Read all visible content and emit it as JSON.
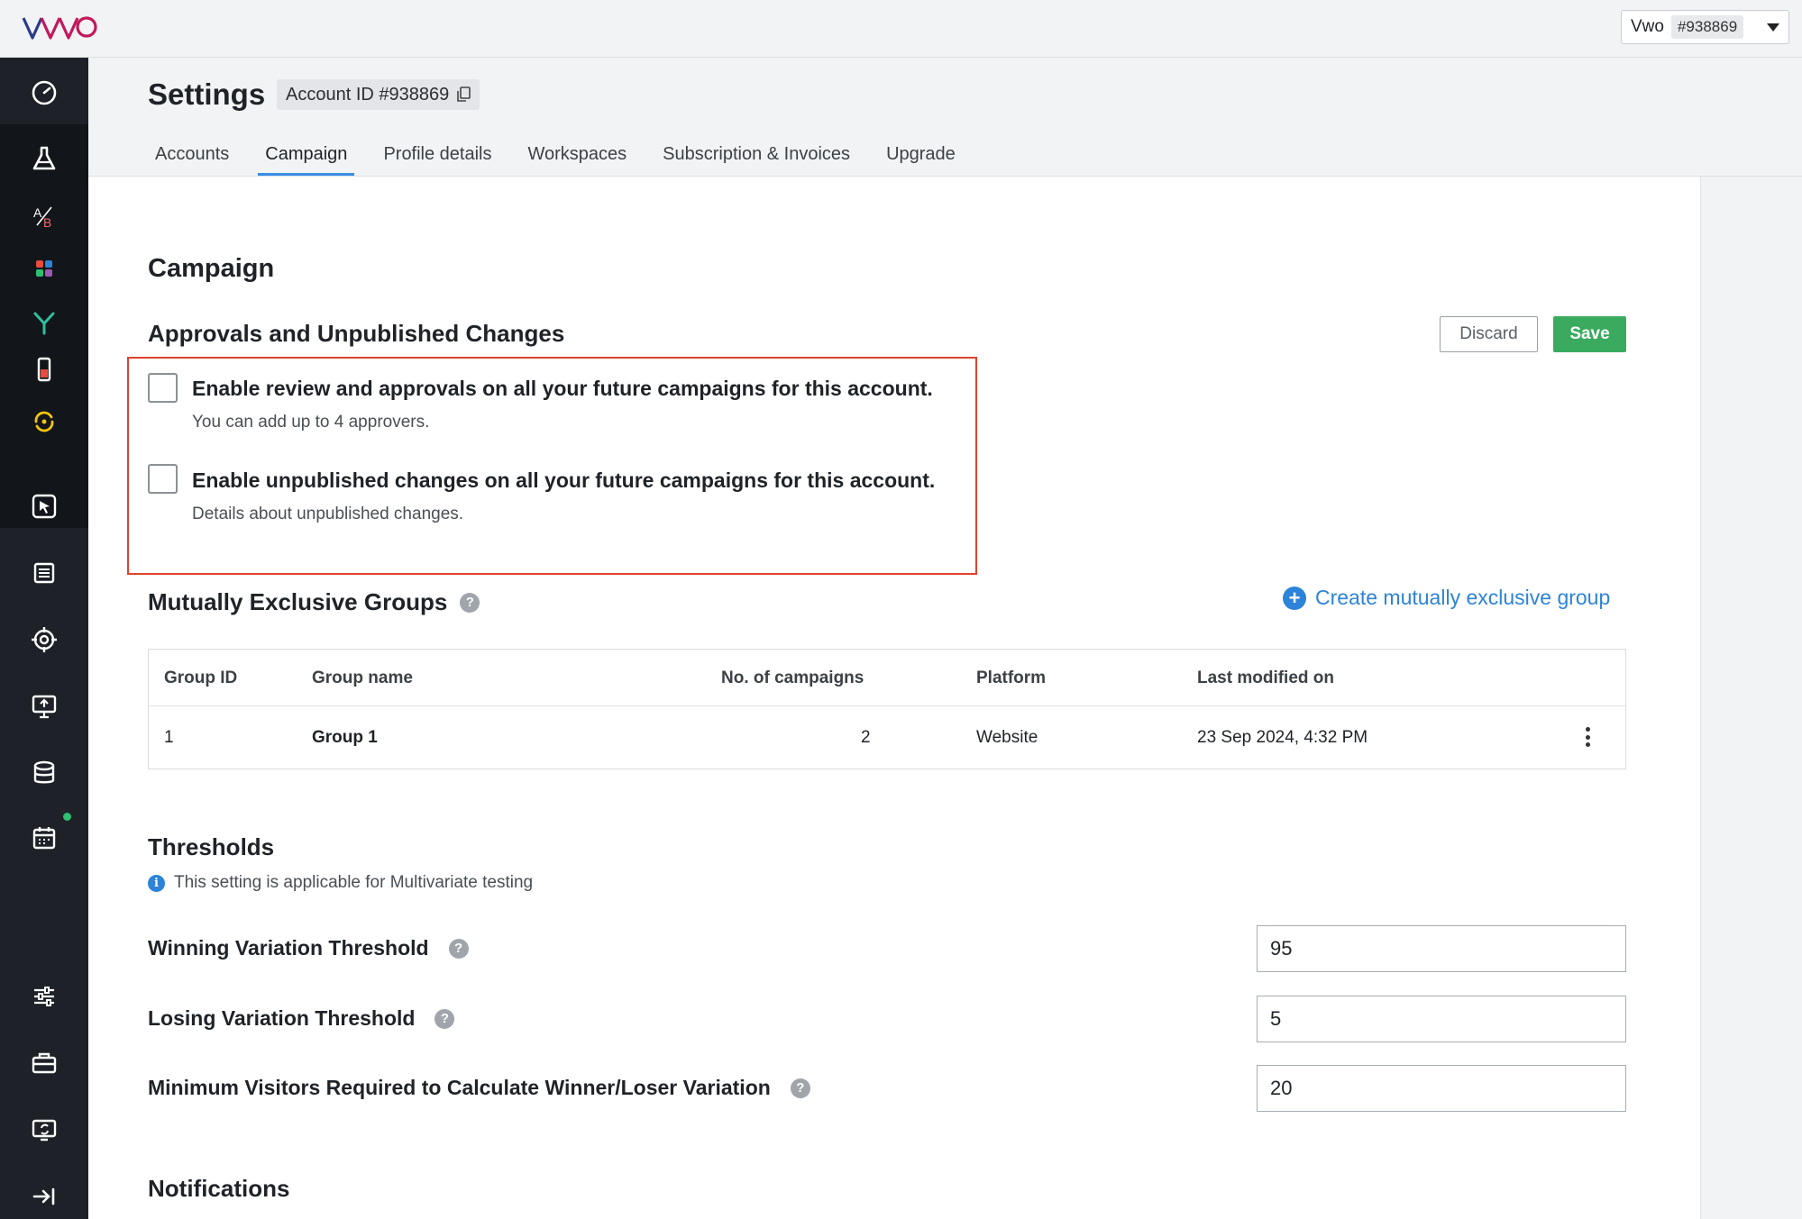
{
  "header": {
    "logo_text": "VWO",
    "account_switcher": {
      "name": "Vwo",
      "id": "#938869"
    }
  },
  "sidebar": {
    "items": [
      {
        "icon": "dashboard-gauge-icon"
      },
      {
        "icon": "flask-icon"
      },
      {
        "icon": "ab-test-icon"
      },
      {
        "icon": "apps-grid-icon"
      },
      {
        "icon": "funnel-branch-icon"
      },
      {
        "icon": "mobile-icon"
      },
      {
        "icon": "refresh-sync-icon"
      },
      {
        "icon": "cursor-click-icon"
      },
      {
        "icon": "list-icon"
      },
      {
        "icon": "target-icon"
      },
      {
        "icon": "presentation-icon"
      },
      {
        "icon": "database-icon"
      },
      {
        "icon": "calendar-icon"
      },
      {
        "icon": "sliders-icon"
      },
      {
        "icon": "toolbox-icon"
      },
      {
        "icon": "screen-sync-icon"
      },
      {
        "icon": "collapse-arrow-icon"
      }
    ]
  },
  "page": {
    "title": "Settings",
    "account_id_label": "Account ID #938869",
    "tabs": [
      {
        "label": "Accounts"
      },
      {
        "label": "Campaign",
        "active": true
      },
      {
        "label": "Profile details"
      },
      {
        "label": "Workspaces"
      },
      {
        "label": "Subscription & Invoices"
      },
      {
        "label": "Upgrade"
      }
    ]
  },
  "campaign": {
    "heading": "Campaign",
    "approvals": {
      "heading": "Approvals and Unpublished Changes",
      "discard_label": "Discard",
      "save_label": "Save",
      "options": [
        {
          "label": "Enable review and approvals on all your future campaigns for this account.",
          "description": "You can add up to 4 approvers.",
          "checked": false
        },
        {
          "label": "Enable unpublished changes on all your future campaigns for this account.",
          "description": "Details about unpublished changes.",
          "checked": false
        }
      ]
    },
    "groups": {
      "heading": "Mutually Exclusive Groups",
      "create_label": "Create mutually exclusive group",
      "columns": [
        "Group ID",
        "Group name",
        "No. of campaigns",
        "Platform",
        "Last modified on"
      ],
      "rows": [
        {
          "id": "1",
          "name": "Group 1",
          "campaigns": "2",
          "platform": "Website",
          "modified": "23 Sep 2024, 4:32 PM"
        }
      ]
    },
    "thresholds": {
      "heading": "Thresholds",
      "info": "This setting is applicable for Multivariate testing",
      "fields": [
        {
          "label": "Winning Variation Threshold",
          "value": "95"
        },
        {
          "label": "Losing Variation Threshold",
          "value": "5"
        },
        {
          "label": "Minimum Visitors Required to Calculate Winner/Loser Variation",
          "value": "20"
        }
      ]
    },
    "notifications": {
      "heading": "Notifications"
    }
  },
  "colors": {
    "accent_blue": "#2d83d8",
    "save_green": "#3aaa5f",
    "highlight_red": "#e0432d",
    "sidebar_bg": "#1e2228"
  }
}
